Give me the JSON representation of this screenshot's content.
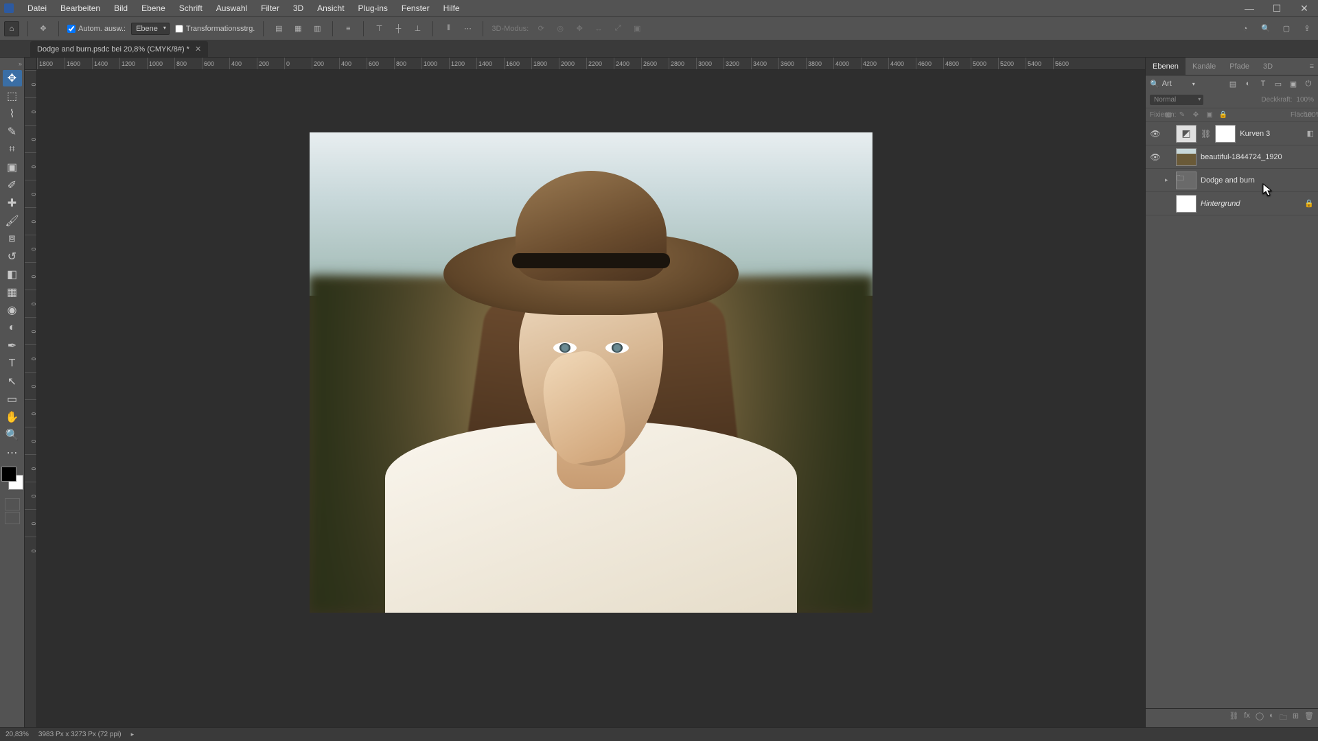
{
  "menubar": [
    "Datei",
    "Bearbeiten",
    "Bild",
    "Ebene",
    "Schrift",
    "Auswahl",
    "Filter",
    "3D",
    "Ansicht",
    "Plug-ins",
    "Fenster",
    "Hilfe"
  ],
  "optbar": {
    "auto_select_label": "Autom. ausw.:",
    "auto_select_target": "Ebene",
    "transform_controls_label": "Transformationsstrg.",
    "mode3d_label": "3D-Modus:"
  },
  "tab": {
    "title": "Dodge and burn.psdc bei 20,8% (CMYK/8#) *"
  },
  "hruler_ticks": [
    "1800",
    "1600",
    "1400",
    "1200",
    "1000",
    "800",
    "600",
    "400",
    "200",
    "0",
    "200",
    "400",
    "600",
    "800",
    "1000",
    "1200",
    "1400",
    "1600",
    "1800",
    "2000",
    "2200",
    "2400",
    "2600",
    "2800",
    "3000",
    "3200",
    "3400",
    "3600",
    "3800",
    "4000",
    "4200",
    "4400",
    "4600",
    "4800",
    "5000",
    "5200",
    "5400",
    "5600"
  ],
  "vruler_ticks": [
    "0",
    "0",
    "0",
    "0",
    "0",
    "0",
    "0",
    "0",
    "0",
    "0",
    "0",
    "0",
    "0",
    "0",
    "0",
    "0",
    "0",
    "0"
  ],
  "panels": {
    "tabs": [
      "Ebenen",
      "Kanäle",
      "Pfade",
      "3D"
    ],
    "search_label": "Art",
    "blend_mode": "Normal",
    "opacity_label": "Deckkraft:",
    "opacity_value": "100%",
    "lock_label": "Fixieren:",
    "fill_label": "Fläche:",
    "fill_value": "100%"
  },
  "layers": [
    {
      "visible": true,
      "type": "adjustment",
      "name": "Kurven 3",
      "mask": true,
      "locked": false,
      "fx": true
    },
    {
      "visible": true,
      "type": "smart",
      "name": "beautiful-1844724_1920",
      "mask": false,
      "locked": false
    },
    {
      "visible": false,
      "type": "group",
      "name": "Dodge and burn",
      "mask": false,
      "locked": false,
      "expandable": true
    },
    {
      "visible": false,
      "type": "bg",
      "name": "Hintergrund",
      "mask": false,
      "locked": true,
      "italic": true
    }
  ],
  "status": {
    "zoom": "20,83%",
    "info": "3983 Px x 3273 Px (72 ppi)"
  }
}
